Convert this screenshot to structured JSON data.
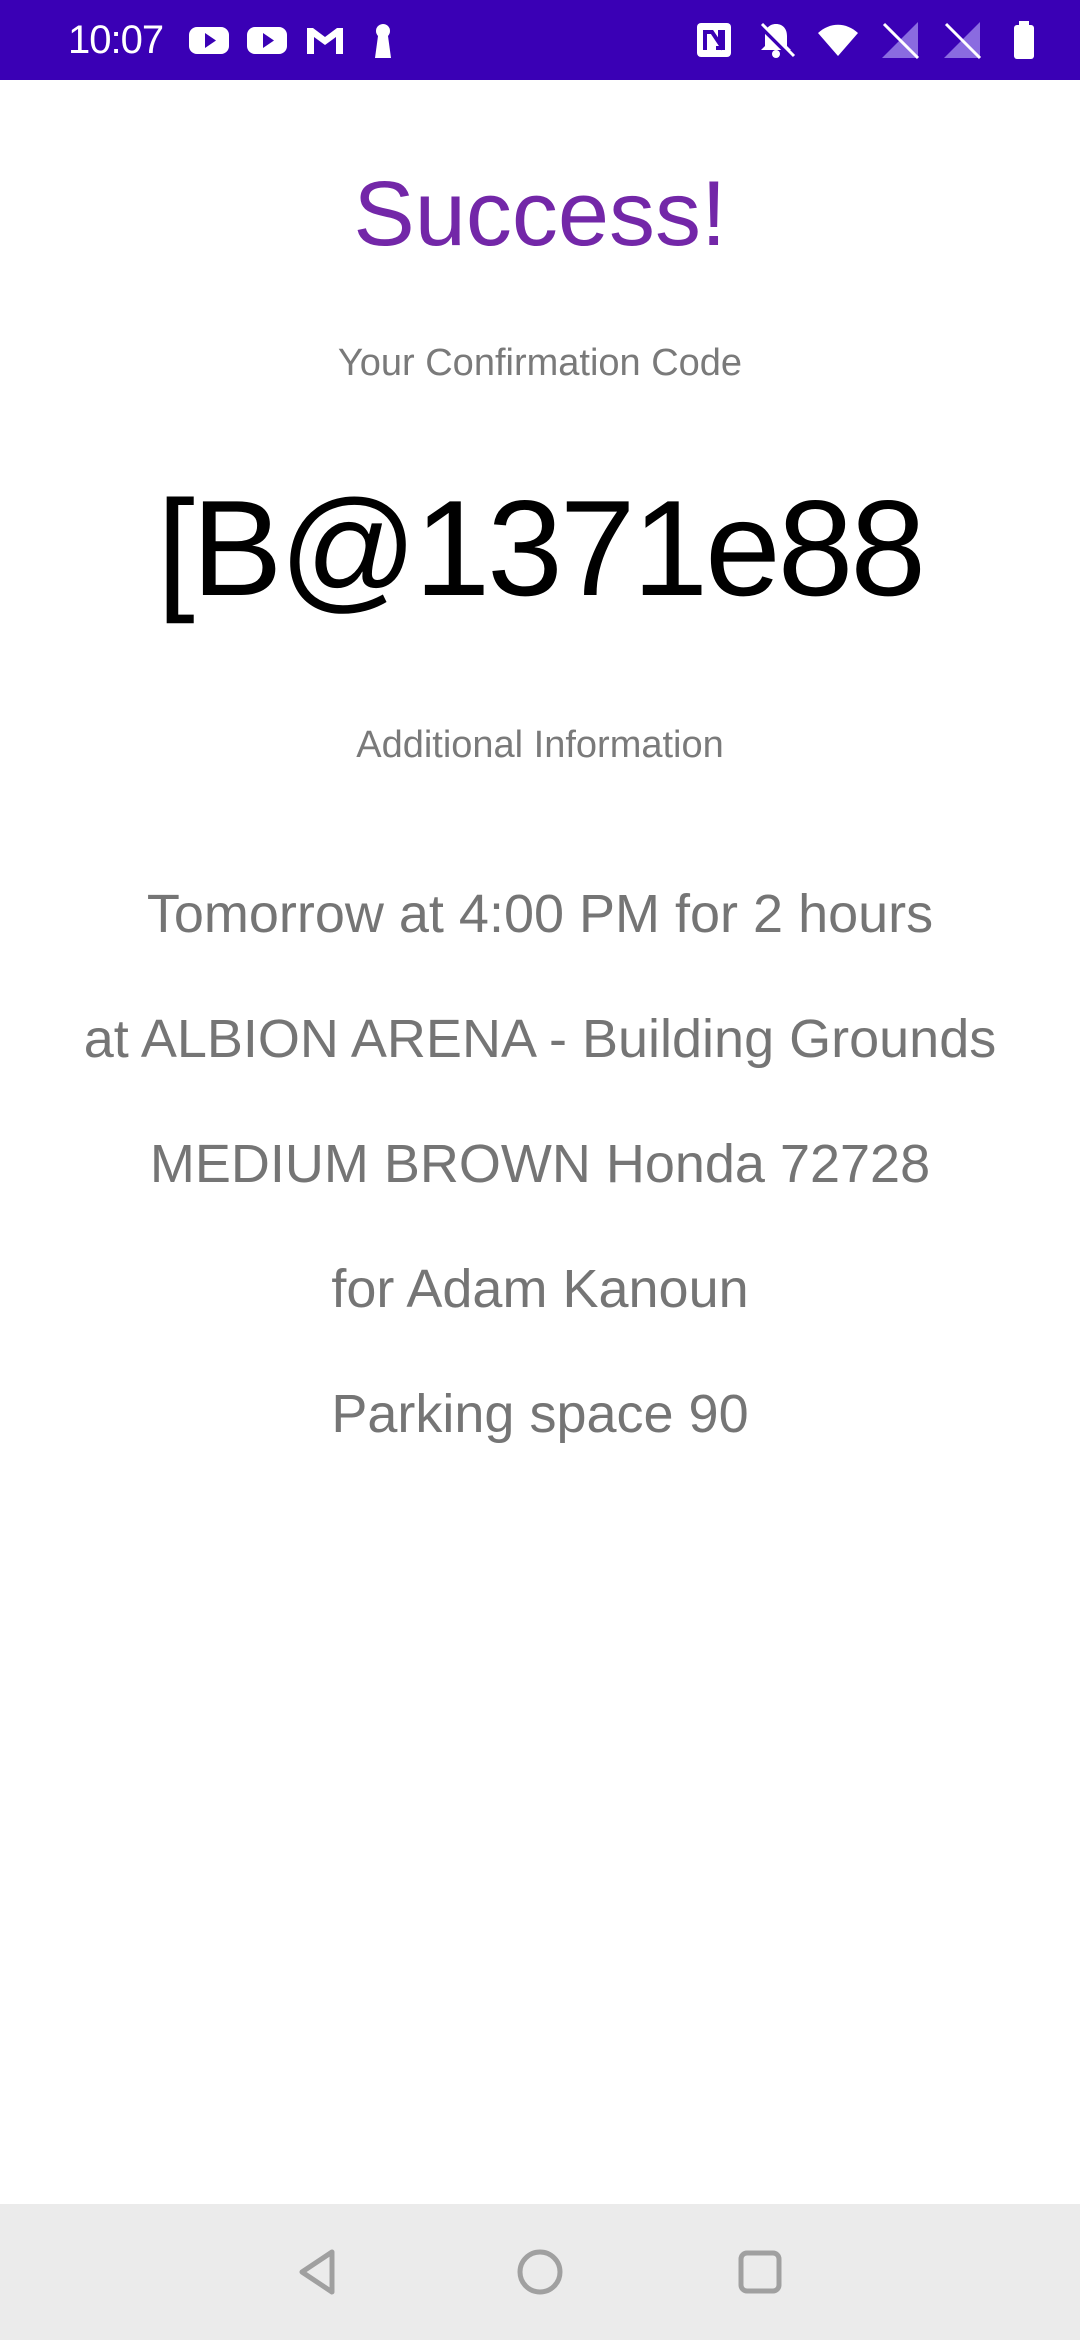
{
  "status_bar": {
    "time": "10:07",
    "left_icons": [
      "youtube-icon",
      "youtube-icon",
      "gmail-icon",
      "keyhole-icon"
    ],
    "right_icons": [
      "nfc-icon",
      "bell-off-icon",
      "wifi-icon",
      "no-sim-icon",
      "no-sim-icon",
      "battery-icon"
    ],
    "background_color": "#3a00b5"
  },
  "main": {
    "title": "Success!",
    "confirmation_label": "Your Confirmation Code",
    "confirmation_code": "[B@1371e88",
    "additional_info_label": "Additional Information",
    "info_lines": [
      "Tomorrow at 4:00 PM for 2 hours",
      "at ALBION ARENA - Building Grounds",
      "MEDIUM BROWN Honda 72728",
      "for Adam Kanoun",
      "Parking space 90"
    ],
    "title_color": "#7327a8"
  },
  "nav_bar": {
    "buttons": [
      "back-icon",
      "home-icon",
      "recents-icon"
    ]
  }
}
